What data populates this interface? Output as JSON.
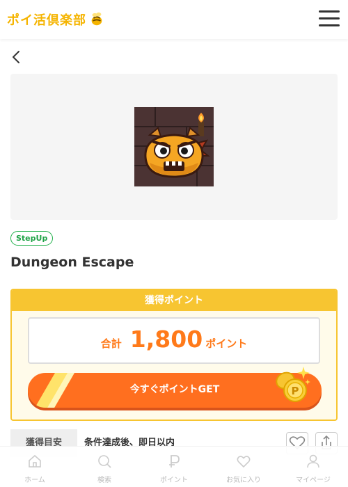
{
  "header": {
    "logo_text": "ポイ活倶楽部",
    "menu_icon": "hamburger-menu-icon"
  },
  "nav": {
    "back_icon": "chevron-left-icon"
  },
  "offer": {
    "badge": "StepUp",
    "title": "Dungeon Escape"
  },
  "points": {
    "heading": "獲得ポイント",
    "total_label": "合計",
    "total_value": "1,800",
    "unit": "ポイント",
    "cta_label": "今すぐポイントGET"
  },
  "estimate": {
    "label": "獲得目安",
    "value": "条件達成後、即日以内"
  },
  "actions": {
    "favorite_icon": "heart-icon",
    "share_icon": "share-icon"
  },
  "bottom_nav": {
    "items": [
      {
        "label": "ホーム",
        "icon": "home-icon"
      },
      {
        "label": "検索",
        "icon": "search-icon"
      },
      {
        "label": "ポイント",
        "icon": "point-icon"
      },
      {
        "label": "お気に入り",
        "icon": "heart-icon"
      },
      {
        "label": "マイページ",
        "icon": "user-icon"
      }
    ]
  },
  "colors": {
    "accent_orange": "#ff6f1f",
    "accent_yellow": "#f7c531",
    "badge_green": "#22b14c"
  }
}
